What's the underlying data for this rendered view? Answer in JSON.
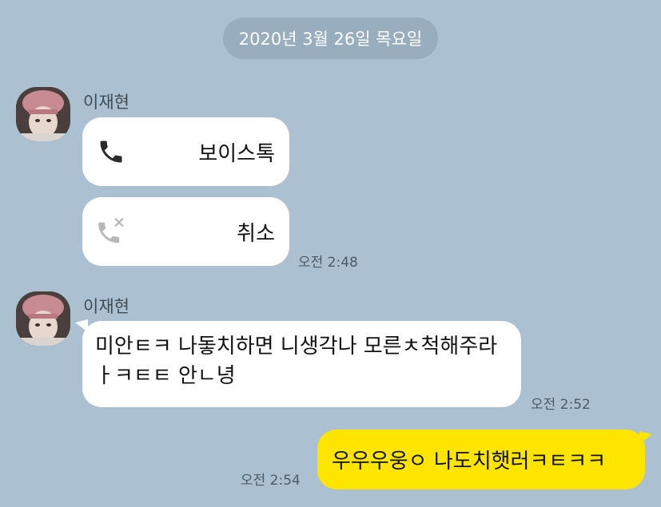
{
  "date_divider": "2020년 3월 26일 목요일",
  "messages": [
    {
      "sender": "이재현",
      "calls": [
        {
          "icon": "phone-icon",
          "label": "보이스톡"
        },
        {
          "icon": "missed-call-icon",
          "label": "취소"
        }
      ],
      "time": "오전 2:48"
    },
    {
      "sender": "이재현",
      "text": "미안ㅌㅋ 나돟치하면 니생각나 모른ㅊ척해주라ㅏㅋㅌㅌ 안ㄴ녕",
      "time": "오전 2:52"
    },
    {
      "text": "우우우웅ㅇ 나도치햇러ㅋㅌㅋㅋ",
      "time": "오전 2:54"
    }
  ],
  "colors": {
    "background": "#abc1d1",
    "incoming_bubble": "#ffffff",
    "outgoing_bubble": "#fee500",
    "date_pill": "#98adbd"
  }
}
